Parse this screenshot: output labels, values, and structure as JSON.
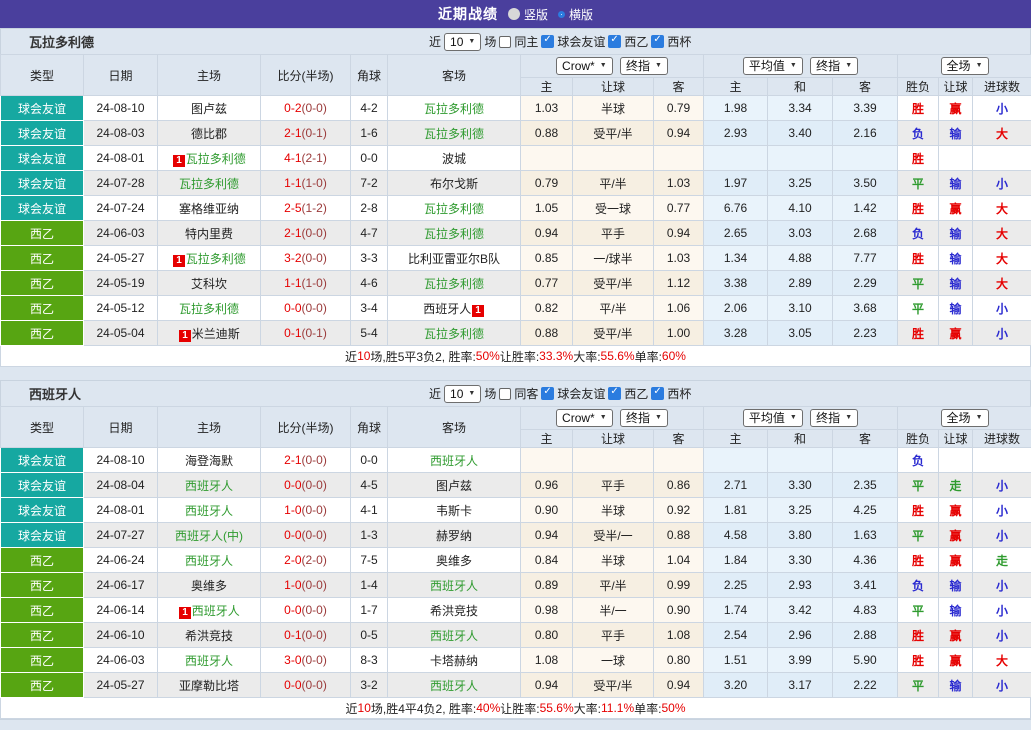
{
  "banner": {
    "title": "近期战绩",
    "layout_options": [
      {
        "label": "竖版",
        "selected": false
      },
      {
        "label": "横版",
        "selected": true
      }
    ]
  },
  "filters": {
    "near": "近",
    "count": "10",
    "games": "场",
    "leagues": [
      {
        "label": "球会友谊",
        "checked": true
      },
      {
        "label": "西乙",
        "checked": true
      },
      {
        "label": "西杯",
        "checked": true
      }
    ]
  },
  "header": {
    "cols": [
      "类型",
      "日期",
      "主场",
      "比分(半场)",
      "角球",
      "客场"
    ],
    "selects": {
      "crow": "Crow*",
      "crow_final": "终指",
      "avg": "平均值",
      "avg_final": "终指",
      "scope": "全场"
    },
    "sub": [
      "主",
      "让球",
      "客",
      "主",
      "和",
      "客",
      "胜负",
      "让球",
      "进球数"
    ]
  },
  "colors": {
    "accent_purple": "#4a3f9d",
    "type_teal": "#16a8a1",
    "type_green": "#57a512",
    "team_green": "#2f9b2f",
    "score_red": "#e60000",
    "result_red": "#e60000",
    "result_green": "#2f9b2f",
    "result_blue": "#2a2ad0"
  },
  "sections": [
    {
      "team": "瓦拉多利德",
      "same_label": "同主",
      "same_checked": false,
      "rows": [
        {
          "type": "球会友谊",
          "tc": "teal",
          "date": "24-08-10",
          "home": {
            "n": "图卢兹"
          },
          "score": "0-2",
          "half": "(0-0)",
          "corner": "4-2",
          "away": {
            "n": "瓦拉多利德",
            "g": 1
          },
          "odds": [
            "1.03",
            "半球",
            "0.79",
            "1.98",
            "3.34",
            "3.39"
          ],
          "res": [
            [
              "胜",
              "r"
            ],
            [
              "赢",
              "r"
            ],
            [
              "小",
              "b"
            ]
          ]
        },
        {
          "type": "球会友谊",
          "tc": "teal",
          "date": "24-08-03",
          "home": {
            "n": "德比郡"
          },
          "score": "2-1",
          "half": "(0-1)",
          "corner": "1-6",
          "away": {
            "n": "瓦拉多利德",
            "g": 1
          },
          "odds": [
            "0.88",
            "受平/半",
            "0.94",
            "2.93",
            "3.40",
            "2.16"
          ],
          "res": [
            [
              "负",
              "b"
            ],
            [
              "输",
              "b"
            ],
            [
              "大",
              "r"
            ]
          ]
        },
        {
          "type": "球会友谊",
          "tc": "teal",
          "date": "24-08-01",
          "home": {
            "n": "瓦拉多利德",
            "g": 1,
            "badge": "1",
            "bpos": "pre"
          },
          "score": "4-1",
          "half": "(2-1)",
          "corner": "0-0",
          "away": {
            "n": "波城"
          },
          "odds": [
            "",
            "",
            "",
            "",
            "",
            ""
          ],
          "res": [
            [
              "胜",
              "r"
            ],
            [
              "",
              ""
            ],
            [
              "",
              ""
            ]
          ]
        },
        {
          "type": "球会友谊",
          "tc": "teal",
          "date": "24-07-28",
          "home": {
            "n": "瓦拉多利德",
            "g": 1
          },
          "score": "1-1",
          "half": "(1-0)",
          "corner": "7-2",
          "away": {
            "n": "布尔戈斯"
          },
          "odds": [
            "0.79",
            "平/半",
            "1.03",
            "1.97",
            "3.25",
            "3.50"
          ],
          "res": [
            [
              "平",
              "g"
            ],
            [
              "输",
              "b"
            ],
            [
              "小",
              "b"
            ]
          ]
        },
        {
          "type": "球会友谊",
          "tc": "teal",
          "date": "24-07-24",
          "home": {
            "n": "塞格维亚纳"
          },
          "score": "2-5",
          "half": "(1-2)",
          "corner": "2-8",
          "away": {
            "n": "瓦拉多利德",
            "g": 1
          },
          "odds": [
            "1.05",
            "受一球",
            "0.77",
            "6.76",
            "4.10",
            "1.42"
          ],
          "res": [
            [
              "胜",
              "r"
            ],
            [
              "赢",
              "r"
            ],
            [
              "大",
              "r"
            ]
          ]
        },
        {
          "type": "西乙",
          "tc": "green",
          "date": "24-06-03",
          "home": {
            "n": "特内里费"
          },
          "score": "2-1",
          "half": "(0-0)",
          "corner": "4-7",
          "away": {
            "n": "瓦拉多利德",
            "g": 1
          },
          "odds": [
            "0.94",
            "平手",
            "0.94",
            "2.65",
            "3.03",
            "2.68"
          ],
          "res": [
            [
              "负",
              "b"
            ],
            [
              "输",
              "b"
            ],
            [
              "大",
              "r"
            ]
          ]
        },
        {
          "type": "西乙",
          "tc": "green",
          "date": "24-05-27",
          "home": {
            "n": "瓦拉多利德",
            "g": 1,
            "badge": "1",
            "bpos": "pre"
          },
          "score": "3-2",
          "half": "(0-0)",
          "corner": "3-3",
          "away": {
            "n": "比利亚雷亚尔B队"
          },
          "odds": [
            "0.85",
            "一/球半",
            "1.03",
            "1.34",
            "4.88",
            "7.77"
          ],
          "res": [
            [
              "胜",
              "r"
            ],
            [
              "输",
              "b"
            ],
            [
              "大",
              "r"
            ]
          ]
        },
        {
          "type": "西乙",
          "tc": "green",
          "date": "24-05-19",
          "home": {
            "n": "艾科坎"
          },
          "score": "1-1",
          "half": "(1-0)",
          "corner": "4-6",
          "away": {
            "n": "瓦拉多利德",
            "g": 1
          },
          "odds": [
            "0.77",
            "受平/半",
            "1.12",
            "3.38",
            "2.89",
            "2.29"
          ],
          "res": [
            [
              "平",
              "g"
            ],
            [
              "输",
              "b"
            ],
            [
              "大",
              "r"
            ]
          ]
        },
        {
          "type": "西乙",
          "tc": "green",
          "date": "24-05-12",
          "home": {
            "n": "瓦拉多利德",
            "g": 1
          },
          "score": "0-0",
          "half": "(0-0)",
          "corner": "3-4",
          "away": {
            "n": "西班牙人",
            "badge": "1",
            "bpos": "post"
          },
          "odds": [
            "0.82",
            "平/半",
            "1.06",
            "2.06",
            "3.10",
            "3.68"
          ],
          "res": [
            [
              "平",
              "g"
            ],
            [
              "输",
              "b"
            ],
            [
              "小",
              "b"
            ]
          ]
        },
        {
          "type": "西乙",
          "tc": "green",
          "date": "24-05-04",
          "home": {
            "n": "米兰迪斯",
            "badge": "1",
            "bpos": "pre"
          },
          "score": "0-1",
          "half": "(0-1)",
          "corner": "5-4",
          "away": {
            "n": "瓦拉多利德",
            "g": 1
          },
          "odds": [
            "0.88",
            "受平/半",
            "1.00",
            "3.28",
            "3.05",
            "2.23"
          ],
          "res": [
            [
              "胜",
              "r"
            ],
            [
              "赢",
              "r"
            ],
            [
              "小",
              "b"
            ]
          ]
        }
      ],
      "summary": [
        [
          "近",
          0
        ],
        [
          "10",
          1
        ],
        [
          "场,胜5平3负2, 胜率:",
          0
        ],
        [
          "50%",
          1
        ],
        [
          " 让胜率:",
          0
        ],
        [
          "33.3%",
          1
        ],
        [
          " 大率:",
          0
        ],
        [
          "55.6%",
          1
        ],
        [
          " 单率:",
          0
        ],
        [
          "60%",
          1
        ]
      ]
    },
    {
      "team": "西班牙人",
      "same_label": "同客",
      "same_checked": false,
      "rows": [
        {
          "type": "球会友谊",
          "tc": "teal",
          "date": "24-08-10",
          "home": {
            "n": "海登海默"
          },
          "score": "2-1",
          "half": "(0-0)",
          "corner": "0-0",
          "away": {
            "n": "西班牙人",
            "g": 1
          },
          "odds": [
            "",
            "",
            "",
            "",
            "",
            ""
          ],
          "res": [
            [
              "负",
              "b"
            ],
            [
              "",
              ""
            ],
            [
              "",
              ""
            ]
          ]
        },
        {
          "type": "球会友谊",
          "tc": "teal",
          "date": "24-08-04",
          "home": {
            "n": "西班牙人",
            "g": 1
          },
          "score": "0-0",
          "half": "(0-0)",
          "corner": "4-5",
          "away": {
            "n": "图卢兹"
          },
          "odds": [
            "0.96",
            "平手",
            "0.86",
            "2.71",
            "3.30",
            "2.35"
          ],
          "res": [
            [
              "平",
              "g"
            ],
            [
              "走",
              "g"
            ],
            [
              "小",
              "b"
            ]
          ]
        },
        {
          "type": "球会友谊",
          "tc": "teal",
          "date": "24-08-01",
          "home": {
            "n": "西班牙人",
            "g": 1
          },
          "score": "1-0",
          "half": "(0-0)",
          "corner": "4-1",
          "away": {
            "n": "韦斯卡"
          },
          "odds": [
            "0.90",
            "半球",
            "0.92",
            "1.81",
            "3.25",
            "4.25"
          ],
          "res": [
            [
              "胜",
              "r"
            ],
            [
              "赢",
              "r"
            ],
            [
              "小",
              "b"
            ]
          ]
        },
        {
          "type": "球会友谊",
          "tc": "teal",
          "date": "24-07-27",
          "home": {
            "n": "西班牙人(中)",
            "g": 1
          },
          "score": "0-0",
          "half": "(0-0)",
          "corner": "1-3",
          "away": {
            "n": "赫罗纳"
          },
          "odds": [
            "0.94",
            "受半/一",
            "0.88",
            "4.58",
            "3.80",
            "1.63"
          ],
          "res": [
            [
              "平",
              "g"
            ],
            [
              "赢",
              "r"
            ],
            [
              "小",
              "b"
            ]
          ]
        },
        {
          "type": "西乙",
          "tc": "green",
          "date": "24-06-24",
          "home": {
            "n": "西班牙人",
            "g": 1
          },
          "score": "2-0",
          "half": "(2-0)",
          "corner": "7-5",
          "away": {
            "n": "奥维多"
          },
          "odds": [
            "0.84",
            "半球",
            "1.04",
            "1.84",
            "3.30",
            "4.36"
          ],
          "res": [
            [
              "胜",
              "r"
            ],
            [
              "赢",
              "r"
            ],
            [
              "走",
              "g"
            ]
          ]
        },
        {
          "type": "西乙",
          "tc": "green",
          "date": "24-06-17",
          "home": {
            "n": "奥维多"
          },
          "score": "1-0",
          "half": "(0-0)",
          "corner": "1-4",
          "away": {
            "n": "西班牙人",
            "g": 1
          },
          "odds": [
            "0.89",
            "平/半",
            "0.99",
            "2.25",
            "2.93",
            "3.41"
          ],
          "res": [
            [
              "负",
              "b"
            ],
            [
              "输",
              "b"
            ],
            [
              "小",
              "b"
            ]
          ]
        },
        {
          "type": "西乙",
          "tc": "green",
          "date": "24-06-14",
          "home": {
            "n": "西班牙人",
            "g": 1,
            "badge": "1",
            "bpos": "pre"
          },
          "score": "0-0",
          "half": "(0-0)",
          "corner": "1-7",
          "away": {
            "n": "希洪竞技"
          },
          "odds": [
            "0.98",
            "半/一",
            "0.90",
            "1.74",
            "3.42",
            "4.83"
          ],
          "res": [
            [
              "平",
              "g"
            ],
            [
              "输",
              "b"
            ],
            [
              "小",
              "b"
            ]
          ]
        },
        {
          "type": "西乙",
          "tc": "green",
          "date": "24-06-10",
          "home": {
            "n": "希洪竞技"
          },
          "score": "0-1",
          "half": "(0-0)",
          "corner": "0-5",
          "away": {
            "n": "西班牙人",
            "g": 1
          },
          "odds": [
            "0.80",
            "平手",
            "1.08",
            "2.54",
            "2.96",
            "2.88"
          ],
          "res": [
            [
              "胜",
              "r"
            ],
            [
              "赢",
              "r"
            ],
            [
              "小",
              "b"
            ]
          ]
        },
        {
          "type": "西乙",
          "tc": "green",
          "date": "24-06-03",
          "home": {
            "n": "西班牙人",
            "g": 1
          },
          "score": "3-0",
          "half": "(0-0)",
          "corner": "8-3",
          "away": {
            "n": "卡塔赫纳"
          },
          "odds": [
            "1.08",
            "一球",
            "0.80",
            "1.51",
            "3.99",
            "5.90"
          ],
          "res": [
            [
              "胜",
              "r"
            ],
            [
              "赢",
              "r"
            ],
            [
              "大",
              "r"
            ]
          ]
        },
        {
          "type": "西乙",
          "tc": "green",
          "date": "24-05-27",
          "home": {
            "n": "亚摩勒比塔"
          },
          "score": "0-0",
          "half": "(0-0)",
          "corner": "3-2",
          "away": {
            "n": "西班牙人",
            "g": 1
          },
          "odds": [
            "0.94",
            "受平/半",
            "0.94",
            "3.20",
            "3.17",
            "2.22"
          ],
          "res": [
            [
              "平",
              "g"
            ],
            [
              "输",
              "b"
            ],
            [
              "小",
              "b"
            ]
          ]
        }
      ],
      "summary": [
        [
          "近",
          0
        ],
        [
          "10",
          1
        ],
        [
          "场,胜4平4负2, 胜率:",
          0
        ],
        [
          "40%",
          1
        ],
        [
          " 让胜率:",
          0
        ],
        [
          "55.6%",
          1
        ],
        [
          " 大率:",
          0
        ],
        [
          "11.1%",
          1
        ],
        [
          " 单率:",
          0
        ],
        [
          "50%",
          1
        ]
      ]
    }
  ]
}
